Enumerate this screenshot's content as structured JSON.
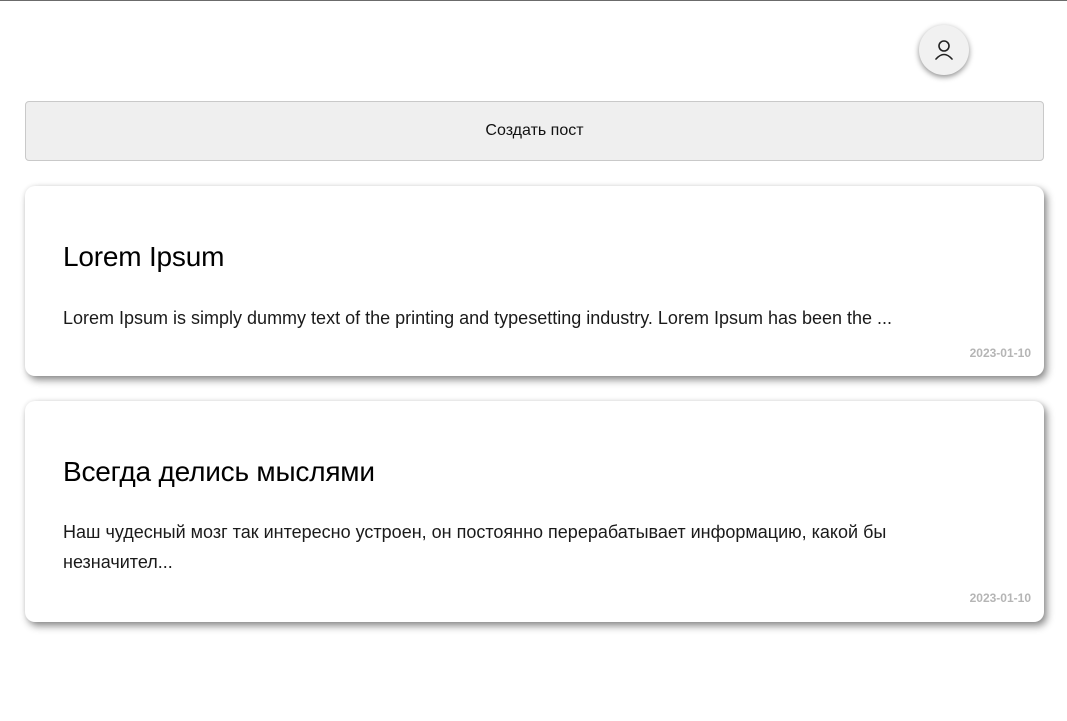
{
  "header": {
    "avatar_icon": "user-icon"
  },
  "actions": {
    "create_post_label": "Создать пост"
  },
  "posts": [
    {
      "title": "Lorem Ipsum",
      "excerpt": "Lorem Ipsum is simply dummy text of the printing and typesetting industry. Lorem Ipsum has been the ...",
      "date": "2023-01-10"
    },
    {
      "title": "Всегда делись мыслями",
      "excerpt": "Наш чудесный мозг так интересно устроен, он постоянно перерабатывает информацию, какой бы незначител...",
      "date": "2023-01-10"
    }
  ]
}
